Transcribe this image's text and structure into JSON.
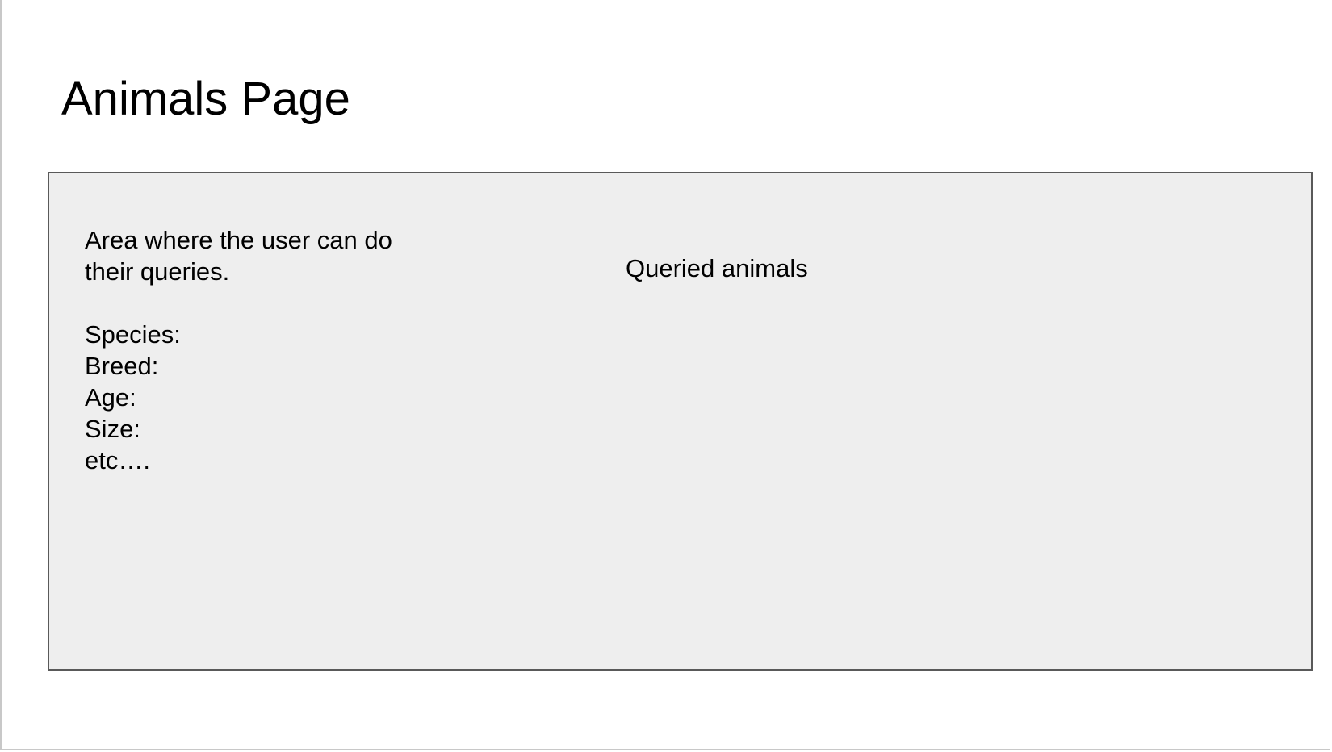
{
  "slide": {
    "title": "Animals Page"
  },
  "panel": {
    "query_area": {
      "description": "Area where the user can do their queries.",
      "fields": [
        {
          "label": "Species:"
        },
        {
          "label": "Breed:"
        },
        {
          "label": "Age:"
        },
        {
          "label": "Size:"
        },
        {
          "label": "etc…."
        }
      ]
    },
    "results_label": "Queried animals"
  },
  "colors": {
    "panel_background": "#eeeeee",
    "panel_border": "#595959",
    "page_background": "#ffffff"
  }
}
